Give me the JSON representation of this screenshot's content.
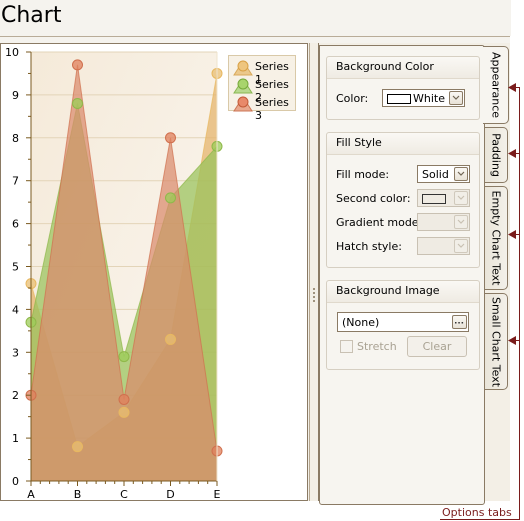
{
  "title": "Chart",
  "chart_data": {
    "type": "area",
    "categories": [
      "A",
      "B",
      "C",
      "D",
      "E"
    ],
    "series": [
      {
        "name": "Series 1",
        "values": [
          4.6,
          0.8,
          1.6,
          3.3,
          9.5
        ],
        "color": "#e8b860",
        "fill": "#e4b36a",
        "marker": "#e8bd72"
      },
      {
        "name": "Series 2",
        "values": [
          3.7,
          8.8,
          2.9,
          6.6,
          7.8
        ],
        "color": "#8fb84a",
        "fill": "#98c25a",
        "marker": "#9ccc58"
      },
      {
        "name": "Series 3",
        "values": [
          2.0,
          9.7,
          1.9,
          8.0,
          0.7
        ],
        "color": "#d0704e",
        "fill": "#d98a6c",
        "marker": "#e0805c"
      }
    ],
    "ylim": [
      0,
      10
    ],
    "yticks": [
      0,
      1,
      2,
      3,
      4,
      5,
      6,
      7,
      8,
      9,
      10
    ],
    "xlabel": "",
    "ylabel": "",
    "grid": true,
    "legend": "top-right",
    "background_gradient": [
      "#f5ead9",
      "#faf6f0"
    ]
  },
  "legend": {
    "items": [
      "Series 1",
      "Series 2",
      "Series 3"
    ]
  },
  "options": {
    "tabs": [
      {
        "label": "Appearance",
        "active": true
      },
      {
        "label": "Padding",
        "active": false
      },
      {
        "label": "Empty Chart Text",
        "active": false
      },
      {
        "label": "Small Chart Text",
        "active": false
      }
    ],
    "background_color": {
      "header": "Background Color",
      "color_label": "Color:",
      "color_value": "White"
    },
    "fill_style": {
      "header": "Fill Style",
      "fill_mode_label": "Fill mode:",
      "fill_mode_value": "Solid",
      "second_color_label": "Second color:",
      "gradient_mode_label": "Gradient mode:",
      "hatch_style_label": "Hatch style:"
    },
    "background_image": {
      "header": "Background Image",
      "image_value": "(None)",
      "browse_label": "...",
      "stretch_label": "Stretch",
      "clear_label": "Clear"
    }
  },
  "annotation": {
    "label": "Options tabs",
    "color": "#7a1c1c"
  }
}
